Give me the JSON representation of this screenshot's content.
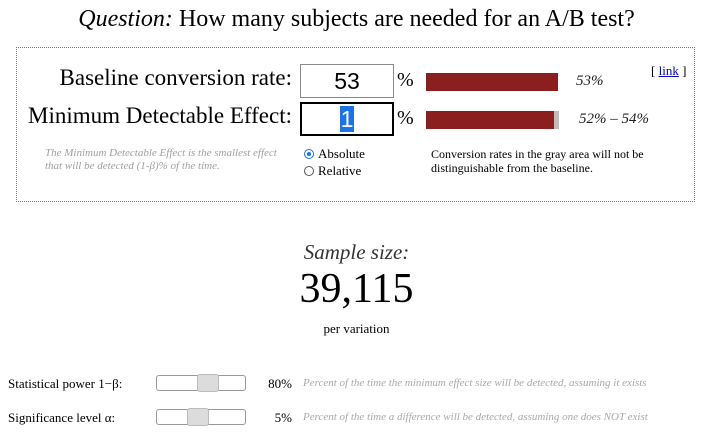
{
  "question": {
    "label": "Question:",
    "text": "How many subjects are needed for an A/B test?"
  },
  "link_text": "link",
  "baseline": {
    "label": "Baseline conversion rate:",
    "value": "53",
    "unit": "%",
    "bar_text": "53%",
    "bar_fraction": 0.53
  },
  "mde": {
    "label": "Minimum Detectable Effect:",
    "value": "1",
    "unit": "%",
    "range_text": "52% – 54%",
    "help": "The Minimum Detectable Effect is the smallest effect that will be detected (1-β)% of the time."
  },
  "mode": {
    "options": [
      "Absolute",
      "Relative"
    ],
    "selected": "Absolute"
  },
  "gray_note": "Conversion rates in the gray area will not be distinguishable from the baseline.",
  "sample": {
    "label": "Sample size:",
    "value": "39,115",
    "sub": "per variation"
  },
  "power": {
    "label": "Statistical power 1−β:",
    "value": "80%",
    "fraction": 0.8,
    "desc": "Percent of the time the minimum effect size will be detected, assuming it exists"
  },
  "significance": {
    "label": "Significance level α:",
    "value": "5%",
    "fraction": 0.05,
    "desc": "Percent of the time a difference will be detected, assuming one does NOT exist"
  },
  "colors": {
    "bar": "#8b1e1e",
    "gray_band": "#bdbdbd",
    "accent": "#1a73e8"
  }
}
